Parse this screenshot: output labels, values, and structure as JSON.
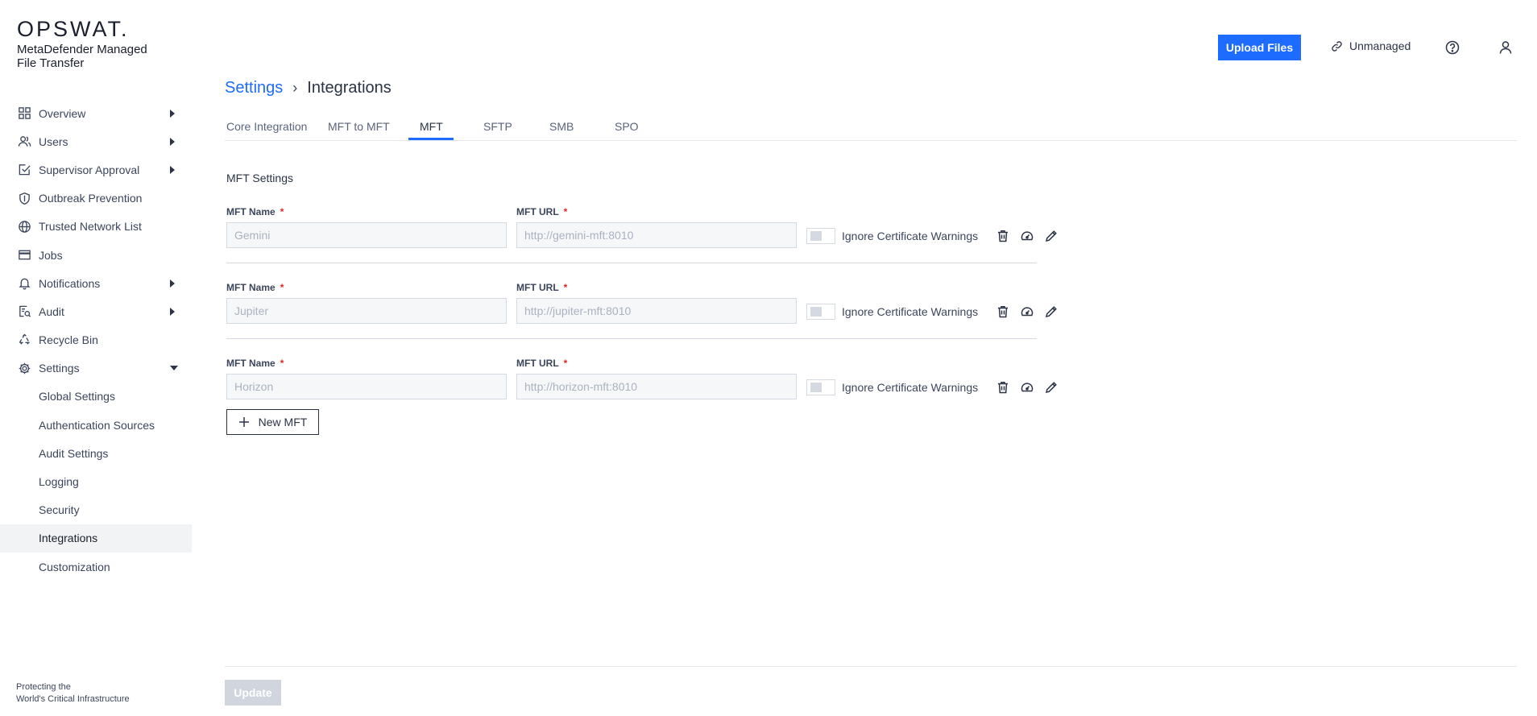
{
  "brand": {
    "logo": "OPSWAT.",
    "product_name": "MetaDefender Managed File Transfer",
    "tagline_line1": "Protecting the",
    "tagline_line2": "World's Critical Infrastructure"
  },
  "header": {
    "upload_label": "Upload Files",
    "unmanaged_label": "Unmanaged",
    "accent_color": "#1d6bff"
  },
  "sidebar": {
    "items": [
      {
        "label": "Overview",
        "icon": "grid-icon",
        "expandable": true
      },
      {
        "label": "Users",
        "icon": "users-icon",
        "expandable": true
      },
      {
        "label": "Supervisor Approval",
        "icon": "approval-icon",
        "expandable": true
      },
      {
        "label": "Outbreak Prevention",
        "icon": "shield-icon",
        "expandable": false
      },
      {
        "label": "Trusted Network List",
        "icon": "globe-icon",
        "expandable": false
      },
      {
        "label": "Jobs",
        "icon": "jobs-icon",
        "expandable": false
      },
      {
        "label": "Notifications",
        "icon": "bell-icon",
        "expandable": true
      },
      {
        "label": "Audit",
        "icon": "audit-icon",
        "expandable": true
      },
      {
        "label": "Recycle Bin",
        "icon": "recycle-icon",
        "expandable": false
      },
      {
        "label": "Settings",
        "icon": "gear-icon",
        "expandable": true,
        "expanded": true
      }
    ],
    "settings_subitems": [
      {
        "label": "Global Settings"
      },
      {
        "label": "Authentication Sources"
      },
      {
        "label": "Audit Settings"
      },
      {
        "label": "Logging"
      },
      {
        "label": "Security"
      },
      {
        "label": "Integrations",
        "active": true
      },
      {
        "label": "Customization"
      }
    ]
  },
  "breadcrumb": {
    "parent": "Settings",
    "separator": "›",
    "current": "Integrations"
  },
  "tabs": [
    {
      "label": "Core Integration"
    },
    {
      "label": "MFT to MFT"
    },
    {
      "label": "MFT",
      "active": true
    },
    {
      "label": "SFTP"
    },
    {
      "label": "SMB"
    },
    {
      "label": "SPO"
    }
  ],
  "content": {
    "section_title": "MFT Settings",
    "name_label": "MFT Name",
    "url_label": "MFT URL",
    "required_mark": "*",
    "toggle_label": "Ignore Certificate Warnings",
    "rows": [
      {
        "name_value": "Gemini",
        "url_value": "http://gemini-mft:8010"
      },
      {
        "name_value": "Jupiter",
        "url_value": "http://jupiter-mft:8010"
      },
      {
        "name_value": "Horizon",
        "url_value": "http://horizon-mft:8010"
      }
    ],
    "new_button_label": "New MFT"
  },
  "footer": {
    "update_label": "Update"
  }
}
